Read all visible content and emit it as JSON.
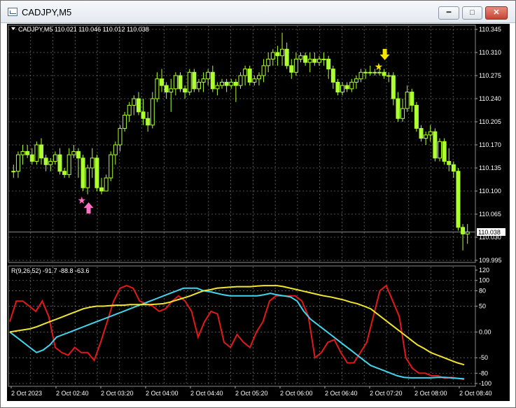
{
  "window": {
    "title": "CADJPY,M5",
    "min_icon": "minimize-icon",
    "max_icon": "maximize-icon",
    "close_icon": "close-icon"
  },
  "price_panel": {
    "header": "CADJPY,M5  110.021 110.046 110.012 110.038",
    "current_price": "110.038",
    "y_ticks": [
      "110.345",
      "110.310",
      "110.275",
      "110.240",
      "110.205",
      "110.170",
      "110.135",
      "110.100",
      "110.065",
      "110.030",
      "109.995"
    ]
  },
  "indicator_panel": {
    "header": "R(9,26,52) -91.7 -88.8 -63.6",
    "y_ticks": [
      "120",
      "100",
      "80",
      "50",
      "0.00",
      "-50",
      "-80",
      "-100"
    ]
  },
  "x_ticks": [
    "2 Oct 2023",
    "2 Oct 02:40",
    "2 Oct 03:20",
    "2 Oct 04:00",
    "2 Oct 04:40",
    "2 Oct 05:20",
    "2 Oct 06:00",
    "2 Oct 06:40",
    "2 Oct 07:20",
    "2 Oct 08:00",
    "2 Oct 08:40"
  ],
  "colors": {
    "background": "#000000",
    "candle": "#adff2f",
    "grid": "#6a6a6a",
    "red_line": "#e31919",
    "cyan_line": "#3fd6ee",
    "yellow_line": "#f2e62c",
    "buy_arrow": "#ff6fc4",
    "sell_arrow": "#f4e400"
  },
  "chart_data": {
    "type": "candlestick",
    "symbol": "CADJPY",
    "timeframe": "M5",
    "ylim": [
      109.995,
      110.345
    ],
    "ohlc": [
      [
        110.13,
        110.14,
        110.12,
        110.13
      ],
      [
        110.13,
        110.16,
        110.12,
        110.155
      ],
      [
        110.155,
        110.17,
        110.14,
        110.16
      ],
      [
        110.16,
        110.17,
        110.15,
        110.155
      ],
      [
        110.155,
        110.165,
        110.14,
        110.145
      ],
      [
        110.145,
        110.175,
        110.14,
        110.17
      ],
      [
        110.17,
        110.18,
        110.14,
        110.15
      ],
      [
        110.15,
        110.155,
        110.13,
        110.14
      ],
      [
        110.14,
        110.15,
        110.13,
        110.145
      ],
      [
        110.145,
        110.16,
        110.14,
        110.155
      ],
      [
        110.155,
        110.165,
        110.125,
        110.13
      ],
      [
        110.13,
        110.135,
        110.12,
        110.125
      ],
      [
        110.125,
        110.165,
        110.12,
        110.155
      ],
      [
        110.155,
        110.17,
        110.15,
        110.16
      ],
      [
        110.16,
        110.165,
        110.12,
        110.15
      ],
      [
        110.15,
        110.155,
        110.1,
        110.105
      ],
      [
        110.105,
        110.14,
        110.095,
        110.135
      ],
      [
        110.135,
        110.165,
        110.12,
        110.15
      ],
      [
        110.15,
        110.155,
        110.1,
        110.105
      ],
      [
        110.105,
        110.12,
        110.095,
        110.1
      ],
      [
        110.1,
        110.125,
        110.1,
        110.12
      ],
      [
        110.12,
        110.16,
        110.115,
        110.155
      ],
      [
        110.155,
        110.175,
        110.14,
        110.17
      ],
      [
        110.17,
        110.2,
        110.16,
        110.195
      ],
      [
        110.195,
        110.22,
        110.19,
        110.215
      ],
      [
        110.215,
        110.235,
        110.205,
        110.23
      ],
      [
        110.23,
        110.245,
        110.215,
        110.24
      ],
      [
        110.24,
        110.25,
        110.215,
        110.22
      ],
      [
        110.22,
        110.24,
        110.2,
        110.21
      ],
      [
        110.21,
        110.22,
        110.19,
        110.2
      ],
      [
        110.2,
        110.25,
        110.195,
        110.24
      ],
      [
        110.24,
        110.28,
        110.235,
        110.27
      ],
      [
        110.27,
        110.285,
        110.25,
        110.26
      ],
      [
        110.26,
        110.265,
        110.24,
        110.25
      ],
      [
        110.25,
        110.27,
        110.22,
        110.255
      ],
      [
        110.255,
        110.28,
        110.245,
        110.275
      ],
      [
        110.275,
        110.28,
        110.25,
        110.255
      ],
      [
        110.255,
        110.26,
        110.24,
        110.25
      ],
      [
        110.25,
        110.285,
        110.245,
        110.28
      ],
      [
        110.28,
        110.285,
        110.25,
        110.255
      ],
      [
        110.255,
        110.27,
        110.25,
        110.265
      ],
      [
        110.265,
        110.28,
        110.25,
        110.27
      ],
      [
        110.27,
        110.285,
        110.26,
        110.28
      ],
      [
        110.28,
        110.29,
        110.25,
        110.255
      ],
      [
        110.255,
        110.265,
        110.245,
        110.26
      ],
      [
        110.26,
        110.27,
        110.255,
        110.265
      ],
      [
        110.265,
        110.27,
        110.25,
        110.26
      ],
      [
        110.26,
        110.27,
        110.255,
        110.265
      ],
      [
        110.265,
        110.27,
        110.235,
        110.26
      ],
      [
        110.26,
        110.28,
        110.255,
        110.275
      ],
      [
        110.275,
        110.29,
        110.26,
        110.285
      ],
      [
        110.285,
        110.29,
        110.26,
        110.265
      ],
      [
        110.265,
        110.275,
        110.26,
        110.27
      ],
      [
        110.27,
        110.28,
        110.26,
        110.275
      ],
      [
        110.275,
        110.3,
        110.265,
        110.29
      ],
      [
        110.29,
        110.31,
        110.28,
        110.3
      ],
      [
        110.3,
        110.315,
        110.29,
        110.31
      ],
      [
        110.31,
        110.32,
        110.29,
        110.305
      ],
      [
        110.305,
        110.34,
        110.29,
        110.315
      ],
      [
        110.315,
        110.325,
        110.285,
        110.29
      ],
      [
        110.29,
        110.3,
        110.27,
        110.28
      ],
      [
        110.28,
        110.31,
        110.275,
        110.3
      ],
      [
        110.3,
        110.31,
        110.295,
        110.305
      ],
      [
        110.305,
        110.31,
        110.29,
        110.295
      ],
      [
        110.295,
        110.31,
        110.28,
        110.3
      ],
      [
        110.3,
        110.31,
        110.29,
        110.295
      ],
      [
        110.295,
        110.305,
        110.29,
        110.3
      ],
      [
        110.3,
        110.31,
        110.29,
        110.3
      ],
      [
        110.3,
        110.305,
        110.27,
        110.285
      ],
      [
        110.285,
        110.29,
        110.255,
        110.265
      ],
      [
        110.265,
        110.27,
        110.245,
        110.25
      ],
      [
        110.25,
        110.265,
        110.245,
        110.26
      ],
      [
        110.26,
        110.265,
        110.25,
        110.255
      ],
      [
        110.255,
        110.27,
        110.25,
        110.265
      ],
      [
        110.265,
        110.275,
        110.255,
        110.27
      ],
      [
        110.27,
        110.285,
        110.265,
        110.28
      ],
      [
        110.28,
        110.285,
        110.27,
        110.28
      ],
      [
        110.28,
        110.29,
        110.275,
        110.28
      ],
      [
        110.28,
        110.285,
        110.275,
        110.28
      ],
      [
        110.28,
        110.285,
        110.275,
        110.28
      ],
      [
        110.28,
        110.285,
        110.27,
        110.275
      ],
      [
        110.275,
        110.28,
        110.265,
        110.275
      ],
      [
        110.275,
        110.28,
        110.23,
        110.24
      ],
      [
        110.24,
        110.25,
        110.205,
        110.21
      ],
      [
        110.21,
        110.24,
        110.205,
        110.225
      ],
      [
        110.225,
        110.26,
        110.22,
        110.25
      ],
      [
        110.25,
        110.255,
        110.22,
        110.23
      ],
      [
        110.23,
        110.235,
        110.19,
        110.195
      ],
      [
        110.195,
        110.2,
        110.175,
        110.18
      ],
      [
        110.18,
        110.19,
        110.17,
        110.185
      ],
      [
        110.185,
        110.2,
        110.175,
        110.19
      ],
      [
        110.19,
        110.195,
        110.145,
        110.15
      ],
      [
        110.15,
        110.18,
        110.145,
        110.175
      ],
      [
        110.175,
        110.18,
        110.14,
        110.145
      ],
      [
        110.145,
        110.165,
        110.13,
        110.14
      ],
      [
        110.14,
        110.145,
        110.12,
        110.13
      ],
      [
        110.13,
        110.135,
        110.04,
        110.045
      ],
      [
        110.045,
        110.05,
        110.01,
        110.035
      ],
      [
        110.035,
        110.05,
        110.02,
        110.038
      ]
    ],
    "signals": [
      {
        "type": "buy",
        "bar": 15,
        "price": 110.085
      },
      {
        "type": "sell",
        "bar": 80,
        "price": 110.29
      }
    ],
    "indicator": {
      "name": "R(9,26,52)",
      "ylim": [
        -100,
        120
      ],
      "levels": [
        100,
        80,
        50,
        0,
        -50,
        -80,
        -100
      ],
      "series": [
        {
          "color": "red",
          "values": [
            20,
            60,
            60,
            50,
            40,
            60,
            30,
            -30,
            -40,
            -45,
            -30,
            -40,
            -40,
            -55,
            -20,
            20,
            60,
            85,
            90,
            85,
            60,
            55,
            50,
            40,
            45,
            60,
            70,
            60,
            40,
            -10,
            20,
            40,
            35,
            -20,
            -30,
            -5,
            -20,
            -30,
            0,
            20,
            60,
            70,
            70,
            70,
            70,
            60,
            30,
            -50,
            -40,
            -20,
            -15,
            -40,
            -60,
            -60,
            -40,
            -20,
            30,
            80,
            90,
            60,
            30,
            -50,
            -70,
            -80,
            -80,
            -85,
            -85,
            -90,
            -88,
            -90,
            -92
          ]
        },
        {
          "color": "cyan",
          "values": [
            0,
            -10,
            -20,
            -30,
            -40,
            -35,
            -25,
            -10,
            -5,
            0,
            5,
            10,
            15,
            20,
            25,
            30,
            35,
            40,
            45,
            50,
            55,
            60,
            65,
            70,
            75,
            80,
            85,
            85,
            85,
            80,
            78,
            75,
            72,
            70,
            70,
            70,
            70,
            70,
            72,
            75,
            72,
            70,
            68,
            60,
            40,
            25,
            15,
            5,
            -5,
            -15,
            -25,
            -35,
            -45,
            -55,
            -65,
            -70,
            -75,
            -80,
            -85,
            -88,
            -89,
            -89,
            -89,
            -89,
            -88,
            -88,
            -89,
            -90,
            -91
          ]
        },
        {
          "color": "yellow",
          "values": [
            0,
            2,
            4,
            6,
            10,
            15,
            20,
            25,
            30,
            35,
            40,
            45,
            48,
            50,
            50,
            51,
            52,
            52,
            53,
            53,
            53,
            53,
            54,
            55,
            58,
            62,
            66,
            70,
            75,
            80,
            82,
            85,
            86,
            87,
            88,
            88,
            88,
            89,
            90,
            90,
            90,
            88,
            85,
            82,
            79,
            76,
            73,
            70,
            68,
            65,
            62,
            58,
            55,
            50,
            45,
            35,
            25,
            15,
            5,
            -5,
            -15,
            -25,
            -32,
            -40,
            -45,
            -50,
            -55,
            -60,
            -63.6
          ]
        }
      ]
    }
  }
}
